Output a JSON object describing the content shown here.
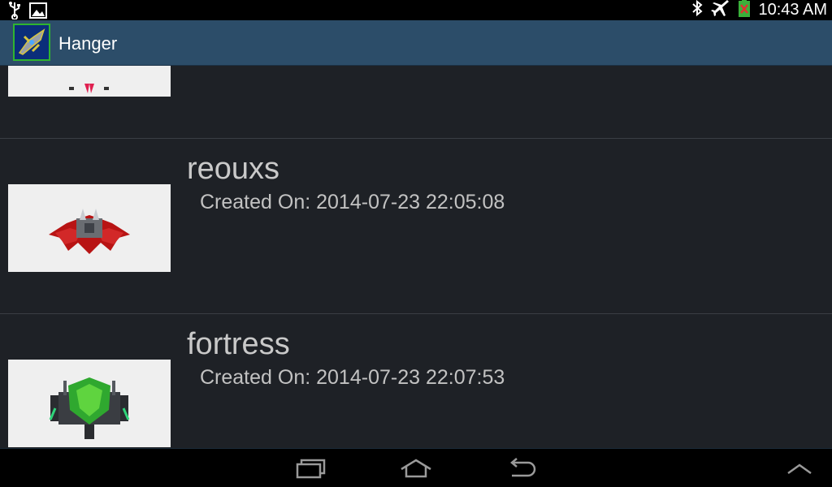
{
  "status_bar": {
    "time": "10:43 AM",
    "icons": [
      "usb-icon",
      "image-icon",
      "bluetooth-icon",
      "airplane-mode-icon",
      "battery-icon"
    ]
  },
  "action_bar": {
    "title": "Hanger",
    "icon": "app-ship-icon"
  },
  "list": {
    "items": [
      {
        "name": "",
        "created": ""
      },
      {
        "name": "reouxs",
        "created": "Created On: 2014-07-23 22:05:08"
      },
      {
        "name": "fortress",
        "created": "Created On: 2014-07-23 22:07:53"
      }
    ]
  },
  "nav_bar": {
    "buttons": [
      "recent-apps-icon",
      "home-icon",
      "back-icon",
      "menu-up-icon"
    ]
  },
  "colors": {
    "action_bar_bg": "#2c4d69",
    "list_bg": "#1e2126",
    "text": "#c9c9c9"
  }
}
